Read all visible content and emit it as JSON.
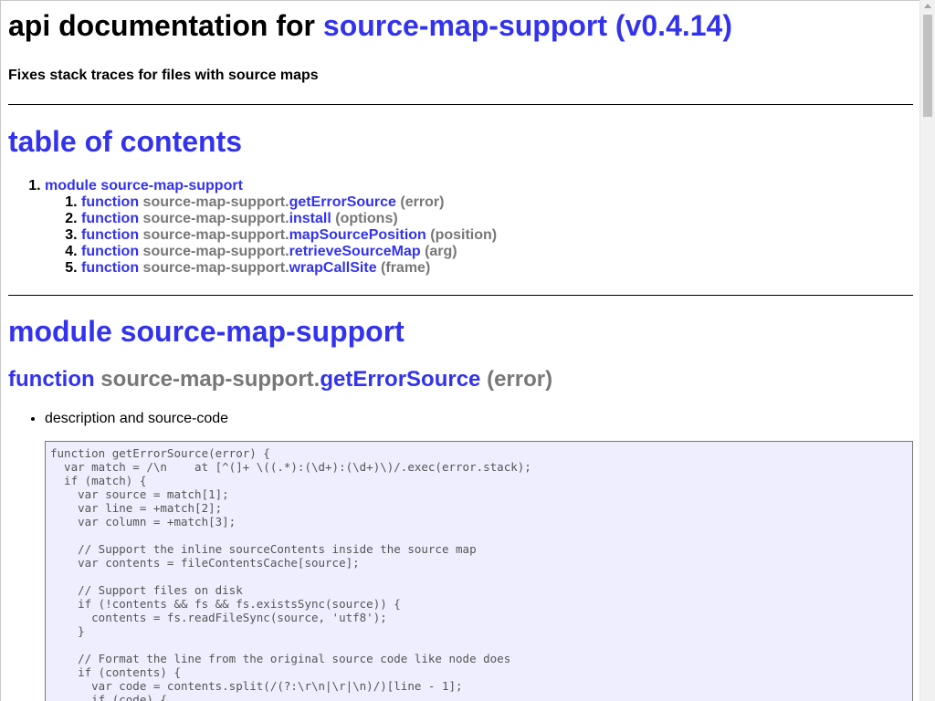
{
  "header": {
    "title_prefix": "api documentation for ",
    "title_link": "source-map-support (v0.4.14)",
    "description": "Fixes stack traces for files with source maps"
  },
  "toc": {
    "heading": "table of contents",
    "module_label": "module source-map-support",
    "items": [
      {
        "keyword": "function",
        "namespace": "source-map-support.",
        "name": "getErrorSource",
        "args": " (error)"
      },
      {
        "keyword": "function",
        "namespace": "source-map-support.",
        "name": "install",
        "args": " (options)"
      },
      {
        "keyword": "function",
        "namespace": "source-map-support.",
        "name": "mapSourcePosition",
        "args": " (position)"
      },
      {
        "keyword": "function",
        "namespace": "source-map-support.",
        "name": "retrieveSourceMap",
        "args": " (arg)"
      },
      {
        "keyword": "function",
        "namespace": "source-map-support.",
        "name": "wrapCallSite",
        "args": " (frame)"
      }
    ]
  },
  "module": {
    "heading": "module source-map-support",
    "function": {
      "keyword": "function",
      "namespace": " source-map-support.",
      "name": "getErrorSource",
      "args": " (error)",
      "desc_item": "description and source-code",
      "code": "function getErrorSource(error) {\n  var match = /\\n    at [^(]+ \\((.*):(\\d+):(\\d+)\\)/.exec(error.stack);\n  if (match) {\n    var source = match[1];\n    var line = +match[2];\n    var column = +match[3];\n\n    // Support the inline sourceContents inside the source map\n    var contents = fileContentsCache[source];\n\n    // Support files on disk\n    if (!contents && fs && fs.existsSync(source)) {\n      contents = fs.readFileSync(source, 'utf8');\n    }\n\n    // Format the line from the original source code like node does\n    if (contents) {\n      var code = contents.split(/(?:\\r\\n|\\r|\\n)/)[line - 1];\n      if (code) {"
    }
  },
  "colors": {
    "link": "#3333ee",
    "muted": "#777777",
    "code_bg": "#eeeeff",
    "code_text": "#555555"
  }
}
